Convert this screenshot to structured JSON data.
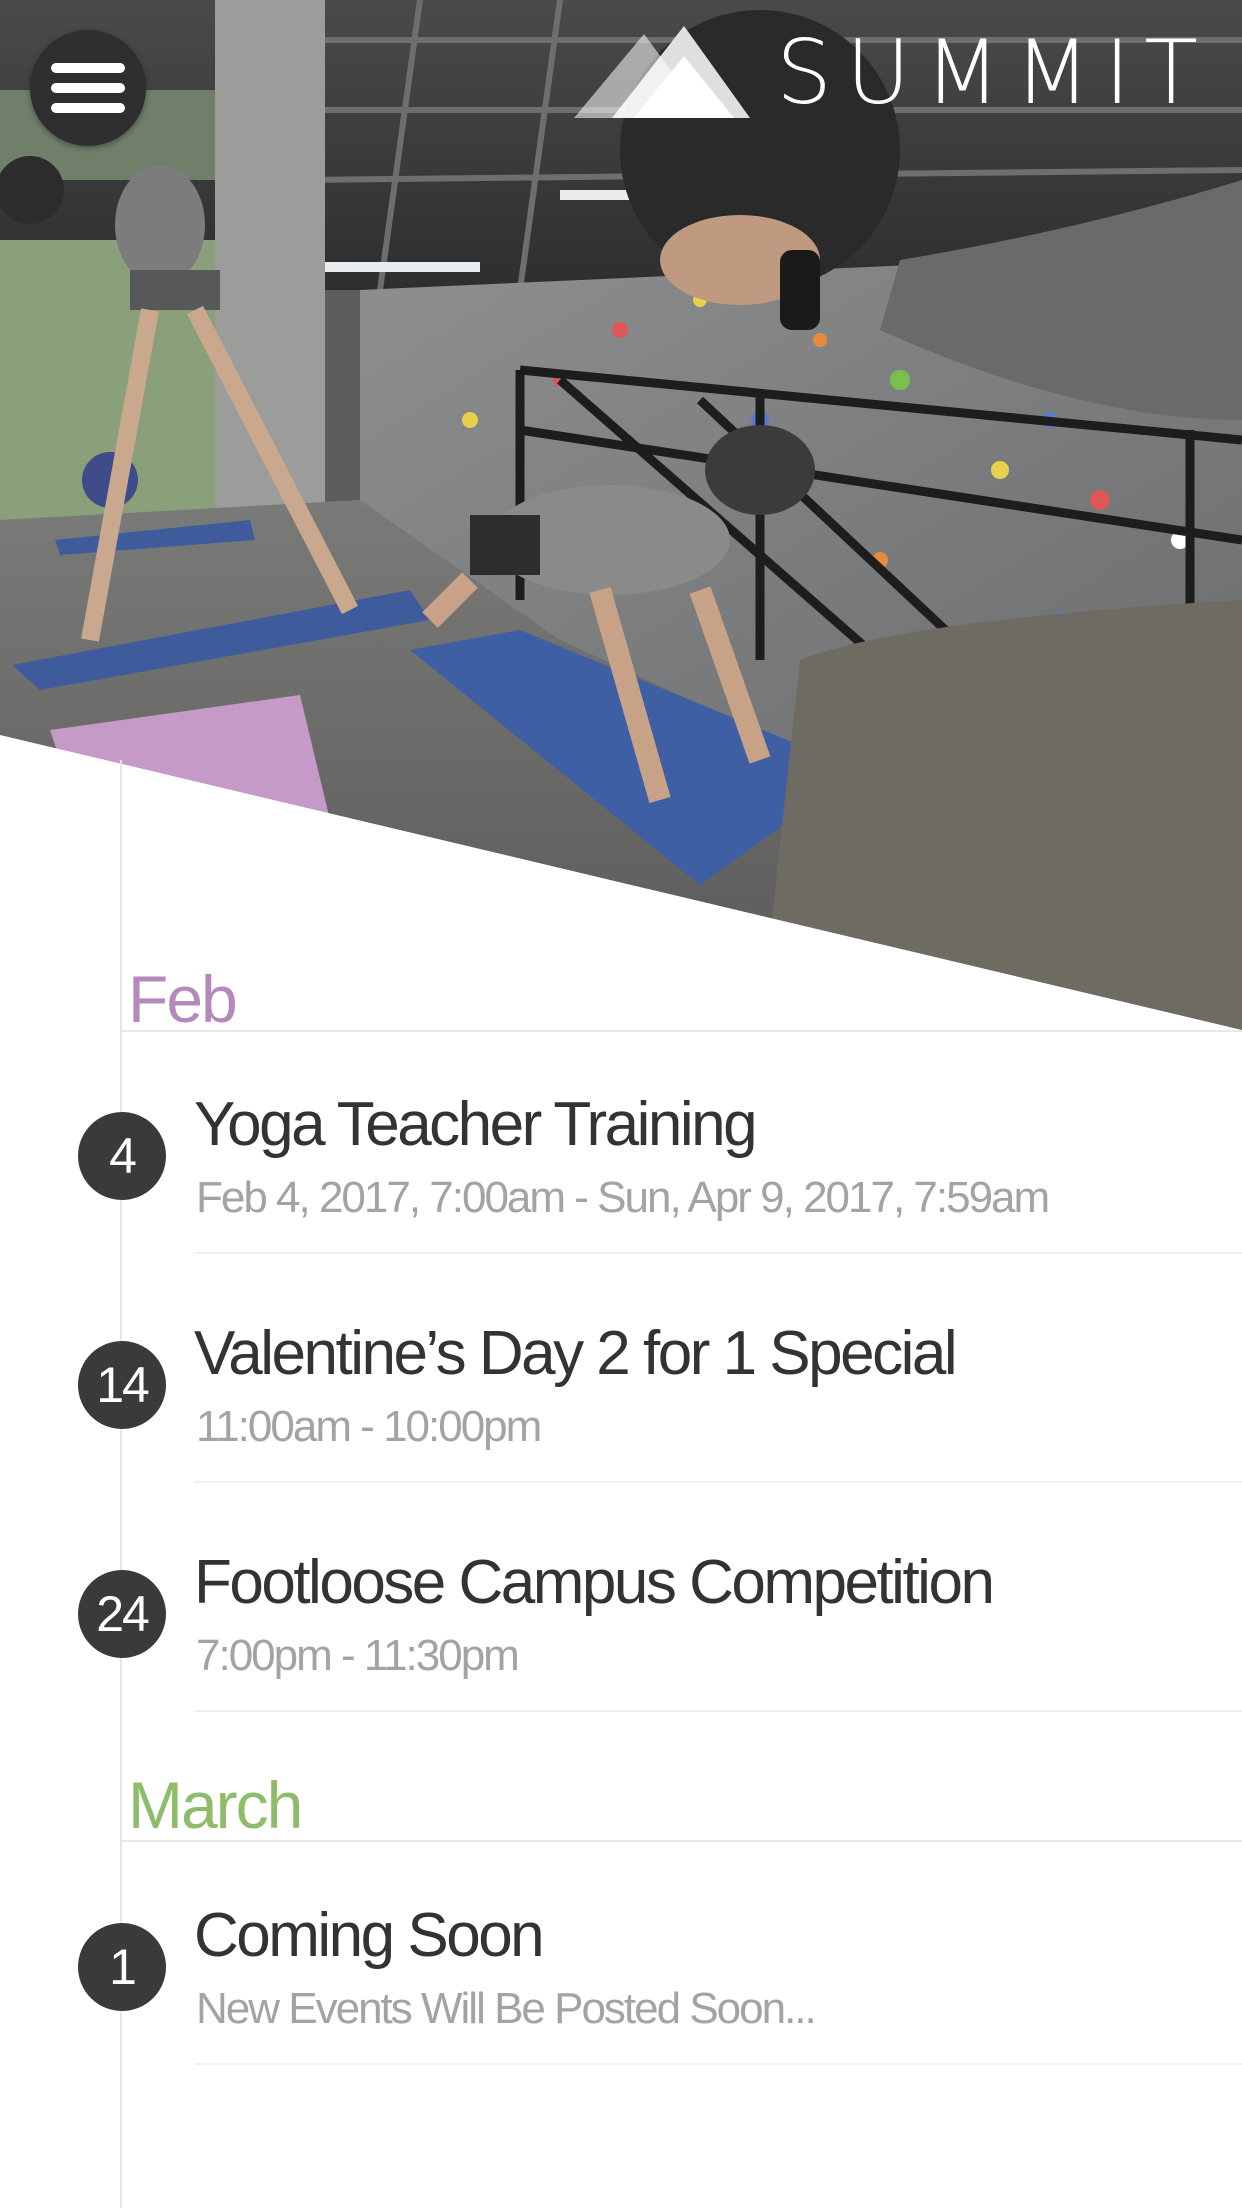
{
  "header": {
    "menu_icon": "hamburger-menu-icon",
    "logo_icon": "mountain-logo-icon",
    "brand": "SUMMIT"
  },
  "colors": {
    "feb": "#b48abc",
    "march": "#8fbc6a",
    "badge": "#3a3a3a",
    "title": "#333333",
    "subtitle": "#a3a3a3"
  },
  "months": [
    {
      "label": "Feb",
      "events": [
        {
          "day": "4",
          "title": "Yoga Teacher Training",
          "time": "Feb 4, 2017, 7:00am - Sun, Apr 9, 2017, 7:59am"
        },
        {
          "day": "14",
          "title": "Valentine’s Day 2 for 1 Special",
          "time": "11:00am - 10:00pm"
        },
        {
          "day": "24",
          "title": "Footloose Campus Competition",
          "time": "7:00pm - 11:30pm"
        }
      ]
    },
    {
      "label": "March",
      "events": [
        {
          "day": "1",
          "title": "Coming Soon",
          "time": "New Events Will Be Posted Soon..."
        }
      ]
    }
  ]
}
